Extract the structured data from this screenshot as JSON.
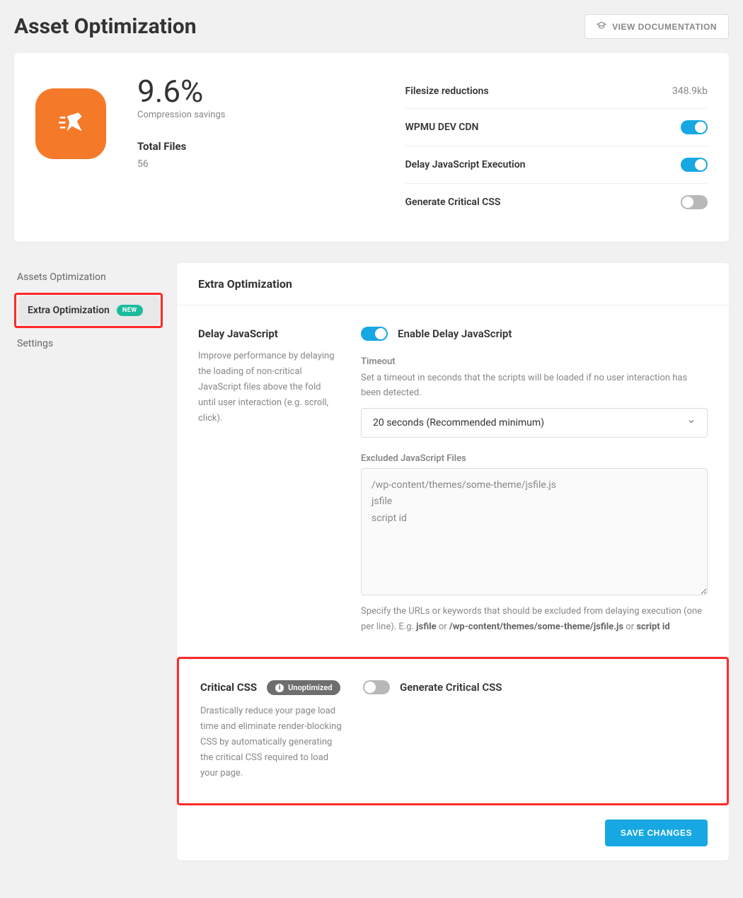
{
  "header": {
    "title": "Asset Optimization",
    "doc_button": "VIEW DOCUMENTATION"
  },
  "summary": {
    "percent": "9.6%",
    "percent_label": "Compression savings",
    "files_title": "Total Files",
    "files_value": "56",
    "rows": [
      {
        "label": "Filesize reductions",
        "value": "348.9kb",
        "type": "text"
      },
      {
        "label": "WPMU DEV CDN",
        "type": "toggle",
        "on": true
      },
      {
        "label": "Delay JavaScript Execution",
        "type": "toggle",
        "on": true
      },
      {
        "label": "Generate Critical CSS",
        "type": "toggle",
        "on": false
      }
    ]
  },
  "sidebar": {
    "items": [
      {
        "label": "Assets Optimization",
        "active": false,
        "new": false
      },
      {
        "label": "Extra Optimization",
        "active": true,
        "new": true
      },
      {
        "label": "Settings",
        "active": false,
        "new": false
      }
    ],
    "new_badge": "NEW"
  },
  "panel": {
    "title": "Extra Optimization",
    "delay_js": {
      "heading": "Delay JavaScript",
      "desc": "Improve performance by delaying the loading of non-critical JavaScript files above the fold until user interaction (e.g. scroll, click).",
      "toggle_label": "Enable Delay JavaScript",
      "toggle_on": true,
      "timeout_label": "Timeout",
      "timeout_help": "Set a timeout in seconds that the scripts will be loaded if no user interaction has been detected.",
      "timeout_value": "20 seconds (Recommended minimum)",
      "excluded_label": "Excluded JavaScript Files",
      "excluded_value": "/wp-content/themes/some-theme/jsfile.js\njsfile\nscript id",
      "excluded_hint_pre": "Specify the URLs or keywords that should be excluded from delaying execution (one per line). E.g. ",
      "excluded_hint_b1": "jsfile",
      "excluded_hint_mid1": " or ",
      "excluded_hint_b2": "/wp-content/themes/some-theme/jsfile.js",
      "excluded_hint_mid2": " or ",
      "excluded_hint_b3": "script id"
    },
    "critical_css": {
      "heading": "Critical CSS",
      "badge": "Unoptimized",
      "desc": "Drastically reduce your page load time and eliminate render-blocking CSS by automatically generating the critical CSS required to load your page.",
      "toggle_label": "Generate Critical CSS",
      "toggle_on": false
    },
    "save_button": "SAVE CHANGES"
  }
}
